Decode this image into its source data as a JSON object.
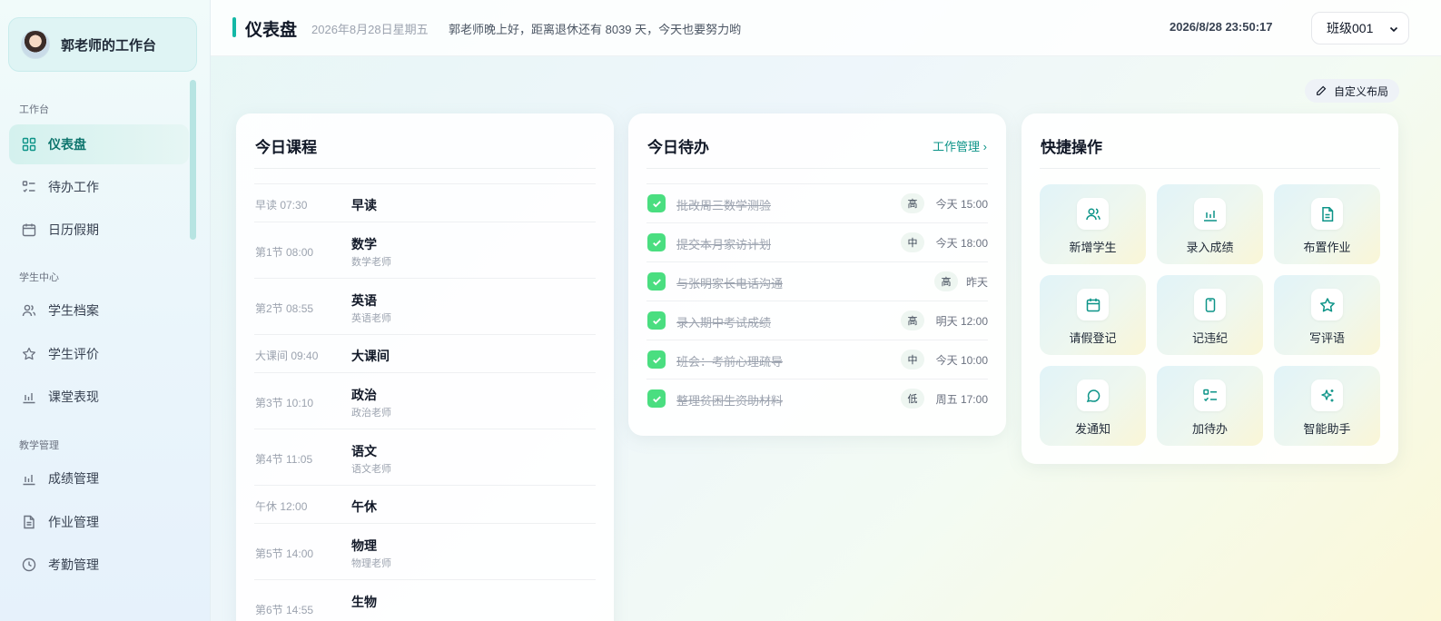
{
  "sidebar": {
    "brand_title": "郭老师的工作台",
    "sections": [
      {
        "label": "工作台"
      },
      {
        "label": "学生中心"
      },
      {
        "label": "教学管理"
      }
    ],
    "items": [
      {
        "label": "仪表盘",
        "icon": "grid-icon",
        "active": true
      },
      {
        "label": "待办工作",
        "icon": "checklist-icon"
      },
      {
        "label": "日历假期",
        "icon": "calendar-icon"
      },
      {
        "label": "学生档案",
        "icon": "users-icon"
      },
      {
        "label": "学生评价",
        "icon": "star-icon"
      },
      {
        "label": "课堂表现",
        "icon": "bar-chart-icon"
      },
      {
        "label": "成绩管理",
        "icon": "bar-chart-icon"
      },
      {
        "label": "作业管理",
        "icon": "document-icon"
      },
      {
        "label": "考勤管理",
        "icon": "clock-icon"
      }
    ]
  },
  "header": {
    "title": "仪表盘",
    "date": "2026年8月28日星期五",
    "greeting": "郭老师晚上好，距离退休还有 8039 天，今天也要努力哟",
    "clock": "2026/8/28 23:50:17",
    "class_select": "班级001"
  },
  "toolbar": {
    "custom_layout_label": "自定义布局"
  },
  "courses": {
    "title": "今日课程",
    "rows": [
      {
        "time": "早读 07:30",
        "name": "早读",
        "teacher": ""
      },
      {
        "time": "第1节 08:00",
        "name": "数学",
        "teacher": "数学老师"
      },
      {
        "time": "第2节 08:55",
        "name": "英语",
        "teacher": "英语老师"
      },
      {
        "time": "大课间 09:40",
        "name": "大课间",
        "teacher": ""
      },
      {
        "time": "第3节 10:10",
        "name": "政治",
        "teacher": "政治老师"
      },
      {
        "time": "第4节 11:05",
        "name": "语文",
        "teacher": "语文老师"
      },
      {
        "time": "午休 12:00",
        "name": "午休",
        "teacher": ""
      },
      {
        "time": "第5节 14:00",
        "name": "物理",
        "teacher": "物理老师"
      },
      {
        "time": "第6节 14:55",
        "name": "生物",
        "teacher": ""
      }
    ]
  },
  "todos": {
    "title": "今日待办",
    "link": "工作管理 ›",
    "items": [
      {
        "text": "批改周三数学测验",
        "priority": "高",
        "due": "今天 15:00",
        "done": true
      },
      {
        "text": "提交本月家访计划",
        "priority": "中",
        "due": "今天 18:00",
        "done": true
      },
      {
        "text": "与张明家长电话沟通",
        "priority": "高",
        "due": "昨天",
        "done": true
      },
      {
        "text": "录入期中考试成绩",
        "priority": "高",
        "due": "明天 12:00",
        "done": true
      },
      {
        "text": "班会：考前心理疏导",
        "priority": "中",
        "due": "今天 10:00",
        "done": true
      },
      {
        "text": "整理贫困生资助材料",
        "priority": "低",
        "due": "周五 17:00",
        "done": true
      }
    ]
  },
  "quick_actions": {
    "title": "快捷操作",
    "items": [
      {
        "label": "新增学生",
        "icon": "user-add-icon"
      },
      {
        "label": "录入成绩",
        "icon": "bar-chart-icon"
      },
      {
        "label": "布置作业",
        "icon": "document-icon"
      },
      {
        "label": "请假登记",
        "icon": "calendar-icon"
      },
      {
        "label": "记违纪",
        "icon": "clipboard-icon"
      },
      {
        "label": "写评语",
        "icon": "star-icon"
      },
      {
        "label": "发通知",
        "icon": "message-icon"
      },
      {
        "label": "加待办",
        "icon": "checklist-icon"
      },
      {
        "label": "智能助手",
        "icon": "sparkle-icon"
      }
    ]
  },
  "colors": {
    "accent": "#14b8a6",
    "check": "#4ade80",
    "icon": "#0d9488"
  }
}
